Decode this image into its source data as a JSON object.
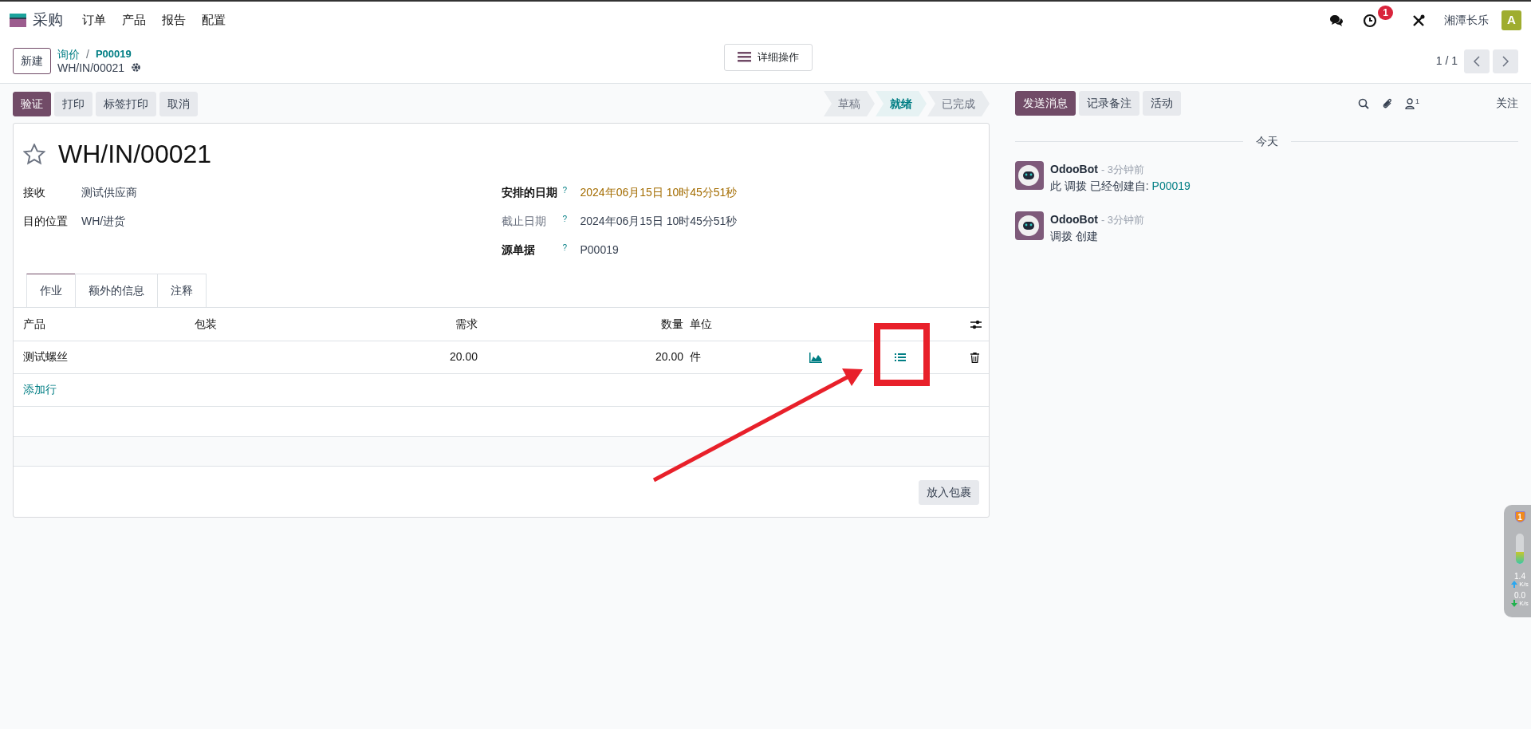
{
  "navbar": {
    "app": "采购",
    "menus": [
      "订单",
      "产品",
      "报告",
      "配置"
    ],
    "activity_badge": "1",
    "company": "湘潭长乐",
    "avatar": "A"
  },
  "control_panel": {
    "new_button": "新建",
    "breadcrumbs": [
      "询价",
      "P00019"
    ],
    "breadcrumb_separator": "/",
    "record": "WH/IN/00021",
    "actions_button": "详细操作",
    "pager": "1 / 1"
  },
  "buttons": [
    {
      "label": "验证",
      "kind": "primary"
    },
    {
      "label": "打印",
      "kind": "secondary"
    },
    {
      "label": "标签打印",
      "kind": "secondary"
    },
    {
      "label": "取消",
      "kind": "secondary"
    }
  ],
  "statusbar": [
    {
      "label": "草稿",
      "selected": false
    },
    {
      "label": "就绪",
      "selected": true
    },
    {
      "label": "已完成",
      "selected": false
    }
  ],
  "form": {
    "title": "WH/IN/00021",
    "starred": false,
    "left_fields": [
      {
        "label": "接收",
        "value": "测试供应商"
      },
      {
        "label": "目的位置",
        "value": "WH/进货"
      }
    ],
    "right_fields": [
      {
        "label": "安排的日期",
        "help": "?",
        "value": "2024年06月15日 10时45分51秒",
        "required": true,
        "warning": true
      },
      {
        "label": "截止日期",
        "help": "?",
        "value": "2024年06月15日 10时45分51秒",
        "required": false,
        "warning": false
      },
      {
        "label": "源单据",
        "help": "?",
        "value": "P00019",
        "required": true,
        "warning": false
      }
    ],
    "tabs": [
      {
        "label": "作业",
        "selected": true
      },
      {
        "label": "额外的信息",
        "selected": false
      },
      {
        "label": "注释",
        "selected": false
      }
    ],
    "table": {
      "columns": [
        "产品",
        "包装",
        "需求",
        "数量",
        "单位"
      ],
      "rows": [
        {
          "product": "测试螺丝",
          "demand": "20.00",
          "quantity": "20.00",
          "unit": "件"
        }
      ]
    },
    "add_line": "添加行",
    "put_in_pack": "放入包裹"
  },
  "chatter": {
    "buttons": [
      {
        "label": "发送消息",
        "kind": "primary"
      },
      {
        "label": "记录备注",
        "kind": "secondary"
      },
      {
        "label": "活动",
        "kind": "secondary"
      }
    ],
    "followers_count": "1",
    "follow": "关注",
    "date_separator": "今天",
    "messages": [
      {
        "author": "OdooBot",
        "time": "- 3分钟前",
        "body": "此 调拨 已经创建自: ",
        "link": "P00019"
      },
      {
        "author": "OdooBot",
        "time": "- 3分钟前",
        "body": "调拨 创建"
      }
    ]
  },
  "speed_widget": {
    "badge": "1",
    "level": 0.4,
    "upload": "1.4",
    "upload_unit": "K/s",
    "download": "0.0",
    "download_unit": "K/s"
  }
}
